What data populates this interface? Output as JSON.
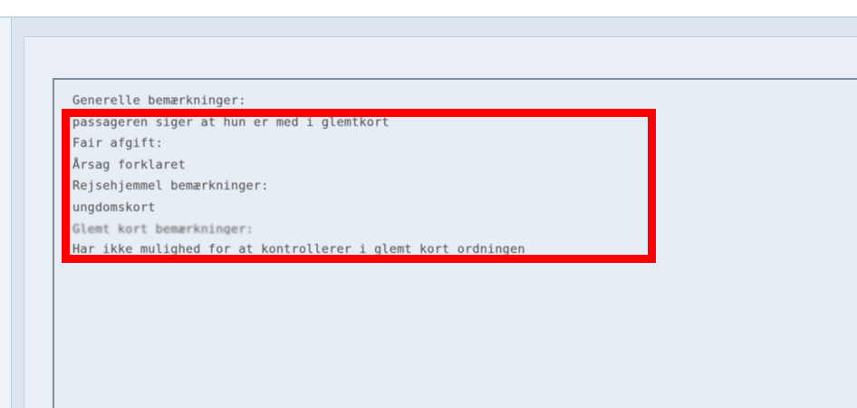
{
  "notes": {
    "lines": [
      "Generelle bemærkninger:",
      "passageren siger at hun er med i glemtkort",
      "Fair afgift:",
      "Årsag forklaret",
      "Rejsehjemmel bemærkninger:",
      "ungdomskort",
      "Glemt kort bemærkninger:",
      "Har ikke mulighed for at kontrollerer i glemt kort ordningen"
    ]
  },
  "colors": {
    "highlight": "#ff0000",
    "panel_background": "#e6edf4",
    "text": "#4a4a4a"
  }
}
